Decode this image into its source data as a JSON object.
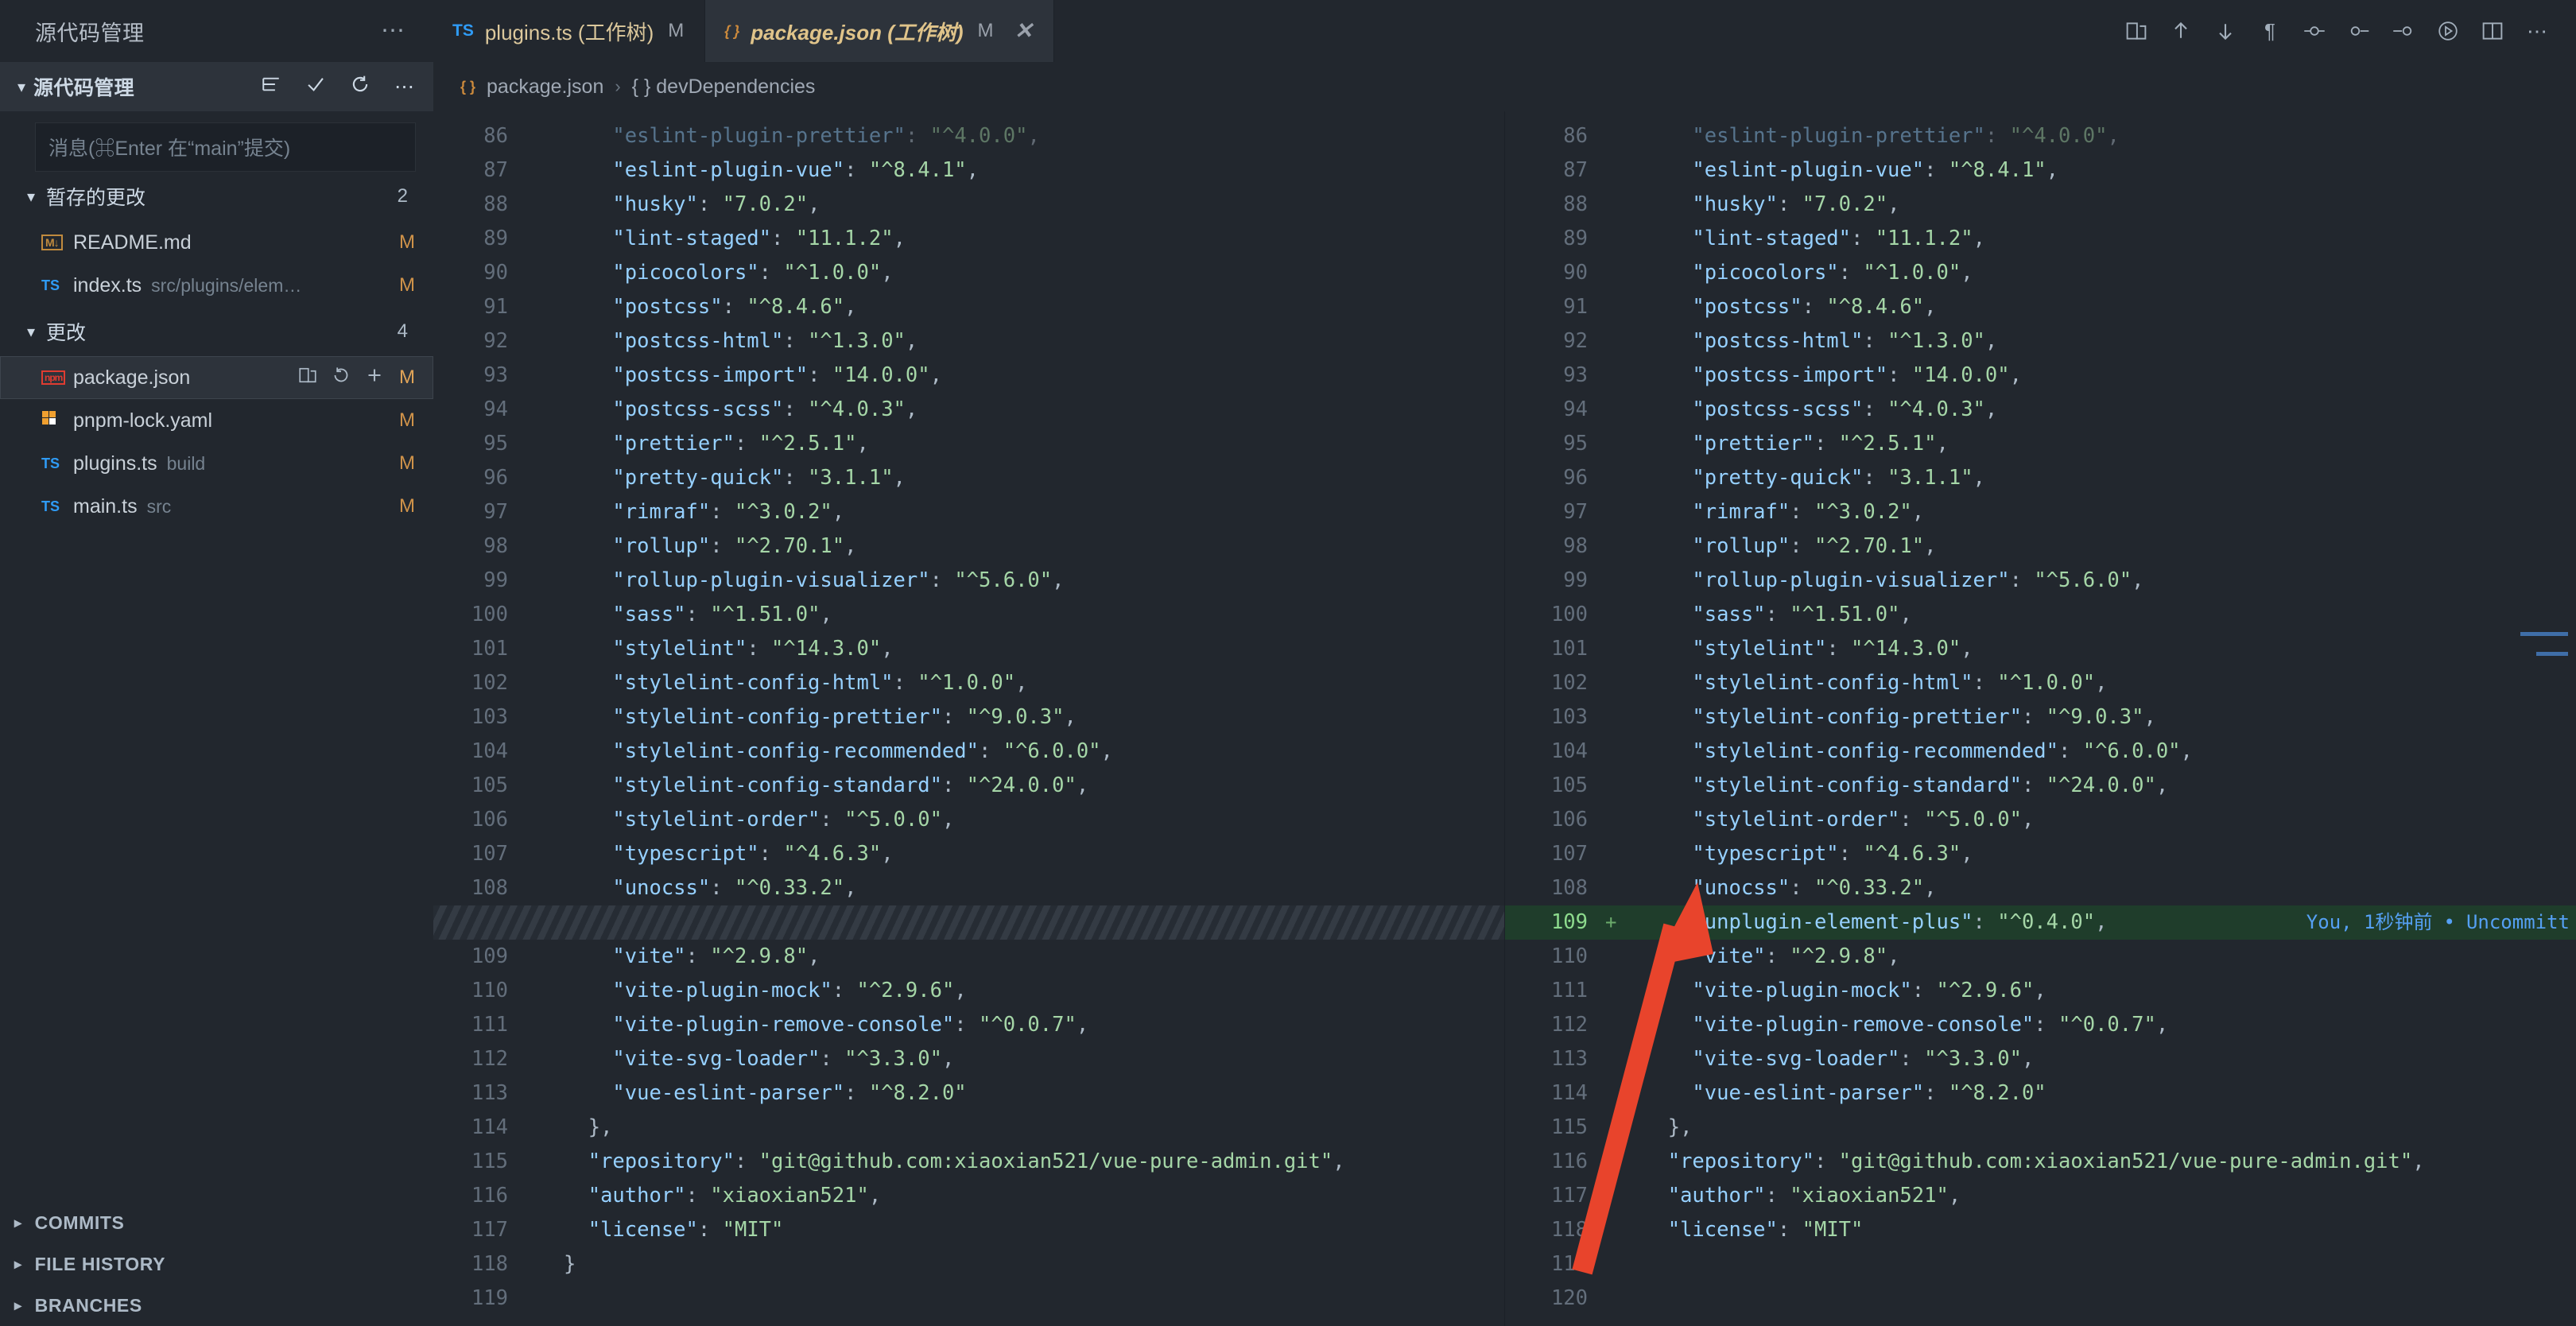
{
  "scm": {
    "title": "源代码管理",
    "more_icon": "ellipsis-icon",
    "subheader_title": "源代码管理",
    "actions": [
      "view-as-tree-icon",
      "commit-checkmark-icon",
      "refresh-icon",
      "ellipsis-icon"
    ],
    "commit_input_placeholder": "消息(⌘Enter 在“main”提交)",
    "sections": [
      {
        "label": "暂存的更改",
        "count": "2"
      },
      {
        "label": "更改",
        "count": "4"
      }
    ],
    "staged_files": [
      {
        "icon": "markdown-file-icon",
        "name": "README.md",
        "path": "",
        "status": "M",
        "selected": false
      },
      {
        "icon": "typescript-file-icon",
        "name": "index.ts",
        "path": "src/plugins/elem…",
        "status": "M",
        "selected": false
      }
    ],
    "changed_files": [
      {
        "icon": "npm-file-icon",
        "name": "package.json",
        "path": "",
        "status": "M",
        "selected": true,
        "row_actions": [
          "open-file-icon",
          "discard-changes-icon",
          "stage-changes-icon"
        ]
      },
      {
        "icon": "yaml-file-icon",
        "name": "pnpm-lock.yaml",
        "path": "",
        "status": "M",
        "selected": false
      },
      {
        "icon": "typescript-file-icon",
        "name": "plugins.ts",
        "path": "build",
        "status": "M",
        "selected": false
      },
      {
        "icon": "typescript-file-icon",
        "name": "main.ts",
        "path": "src",
        "status": "M",
        "selected": false
      }
    ],
    "bottom_sections": [
      "COMMITS",
      "FILE HISTORY",
      "BRANCHES"
    ]
  },
  "tabs": [
    {
      "icon": "typescript-file-icon",
      "label": "plugins.ts (工作树)",
      "badge": "M",
      "active": false,
      "closable": false
    },
    {
      "icon": "json-file-icon",
      "label": "package.json (工作树)",
      "badge": "M",
      "active": true,
      "closable": true
    }
  ],
  "title_actions": [
    "open-changes-icon",
    "previous-change-icon",
    "next-change-icon",
    "toggle-whitespace-icon",
    "toggle-inline-view-icon",
    "collapse-unchanged-icon",
    "expand-unchanged-icon",
    "run-icon",
    "split-editor-icon",
    "ellipsis-icon"
  ],
  "breadcrumb": {
    "icon": "json-file-icon",
    "items": [
      "package.json",
      "{ } devDependencies"
    ],
    "separator": "›"
  },
  "blame": {
    "author": "You,",
    "time": "1秒钟前",
    "dot": "•",
    "message": "Uncommitt"
  },
  "diff": {
    "left": [
      {
        "num": "86",
        "text": "    \"eslint-plugin-prettier\": \"^4.0.0\",",
        "faded": true
      },
      {
        "num": "87",
        "text": "    \"eslint-plugin-vue\": \"^8.4.1\","
      },
      {
        "num": "88",
        "text": "    \"husky\": \"7.0.2\","
      },
      {
        "num": "89",
        "text": "    \"lint-staged\": \"11.1.2\","
      },
      {
        "num": "90",
        "text": "    \"picocolors\": \"^1.0.0\","
      },
      {
        "num": "91",
        "text": "    \"postcss\": \"^8.4.6\","
      },
      {
        "num": "92",
        "text": "    \"postcss-html\": \"^1.3.0\","
      },
      {
        "num": "93",
        "text": "    \"postcss-import\": \"14.0.0\","
      },
      {
        "num": "94",
        "text": "    \"postcss-scss\": \"^4.0.3\","
      },
      {
        "num": "95",
        "text": "    \"prettier\": \"^2.5.1\","
      },
      {
        "num": "96",
        "text": "    \"pretty-quick\": \"3.1.1\","
      },
      {
        "num": "97",
        "text": "    \"rimraf\": \"^3.0.2\","
      },
      {
        "num": "98",
        "text": "    \"rollup\": \"^2.70.1\","
      },
      {
        "num": "99",
        "text": "    \"rollup-plugin-visualizer\": \"^5.6.0\","
      },
      {
        "num": "100",
        "text": "    \"sass\": \"^1.51.0\","
      },
      {
        "num": "101",
        "text": "    \"stylelint\": \"^14.3.0\","
      },
      {
        "num": "102",
        "text": "    \"stylelint-config-html\": \"^1.0.0\","
      },
      {
        "num": "103",
        "text": "    \"stylelint-config-prettier\": \"^9.0.3\","
      },
      {
        "num": "104",
        "text": "    \"stylelint-config-recommended\": \"^6.0.0\","
      },
      {
        "num": "105",
        "text": "    \"stylelint-config-standard\": \"^24.0.0\","
      },
      {
        "num": "106",
        "text": "    \"stylelint-order\": \"^5.0.0\","
      },
      {
        "num": "107",
        "text": "    \"typescript\": \"^4.6.3\","
      },
      {
        "num": "108",
        "text": "    \"unocss\": \"^0.33.2\","
      },
      {
        "num": "",
        "text": "",
        "hatch": true
      },
      {
        "num": "109",
        "text": "    \"vite\": \"^2.9.8\","
      },
      {
        "num": "110",
        "text": "    \"vite-plugin-mock\": \"^2.9.6\","
      },
      {
        "num": "111",
        "text": "    \"vite-plugin-remove-console\": \"^0.0.7\","
      },
      {
        "num": "112",
        "text": "    \"vite-svg-loader\": \"^3.3.0\","
      },
      {
        "num": "113",
        "text": "    \"vue-eslint-parser\": \"^8.2.0\""
      },
      {
        "num": "114",
        "text": "  },"
      },
      {
        "num": "115",
        "text": "  \"repository\": \"git@github.com:xiaoxian521/vue-pure-admin.git\","
      },
      {
        "num": "116",
        "text": "  \"author\": \"xiaoxian521\","
      },
      {
        "num": "117",
        "text": "  \"license\": \"MIT\""
      },
      {
        "num": "118",
        "text": "}"
      },
      {
        "num": "119",
        "text": ""
      }
    ],
    "right": [
      {
        "num": "86",
        "text": "    \"eslint-plugin-prettier\": \"^4.0.0\",",
        "faded": true
      },
      {
        "num": "87",
        "text": "    \"eslint-plugin-vue\": \"^8.4.1\","
      },
      {
        "num": "88",
        "text": "    \"husky\": \"7.0.2\","
      },
      {
        "num": "89",
        "text": "    \"lint-staged\": \"11.1.2\","
      },
      {
        "num": "90",
        "text": "    \"picocolors\": \"^1.0.0\","
      },
      {
        "num": "91",
        "text": "    \"postcss\": \"^8.4.6\","
      },
      {
        "num": "92",
        "text": "    \"postcss-html\": \"^1.3.0\","
      },
      {
        "num": "93",
        "text": "    \"postcss-import\": \"14.0.0\","
      },
      {
        "num": "94",
        "text": "    \"postcss-scss\": \"^4.0.3\","
      },
      {
        "num": "95",
        "text": "    \"prettier\": \"^2.5.1\","
      },
      {
        "num": "96",
        "text": "    \"pretty-quick\": \"3.1.1\","
      },
      {
        "num": "97",
        "text": "    \"rimraf\": \"^3.0.2\","
      },
      {
        "num": "98",
        "text": "    \"rollup\": \"^2.70.1\","
      },
      {
        "num": "99",
        "text": "    \"rollup-plugin-visualizer\": \"^5.6.0\","
      },
      {
        "num": "100",
        "text": "    \"sass\": \"^1.51.0\","
      },
      {
        "num": "101",
        "text": "    \"stylelint\": \"^14.3.0\","
      },
      {
        "num": "102",
        "text": "    \"stylelint-config-html\": \"^1.0.0\","
      },
      {
        "num": "103",
        "text": "    \"stylelint-config-prettier\": \"^9.0.3\","
      },
      {
        "num": "104",
        "text": "    \"stylelint-config-recommended\": \"^6.0.0\","
      },
      {
        "num": "105",
        "text": "    \"stylelint-config-standard\": \"^24.0.0\","
      },
      {
        "num": "106",
        "text": "    \"stylelint-order\": \"^5.0.0\","
      },
      {
        "num": "107",
        "text": "    \"typescript\": \"^4.6.3\","
      },
      {
        "num": "108",
        "text": "    \"unocss\": \"^0.33.2\","
      },
      {
        "num": "109",
        "text": "    \"unplugin-element-plus\": \"^0.4.0\",",
        "added": true,
        "sign": "+"
      },
      {
        "num": "110",
        "text": "    \"vite\": \"^2.9.8\","
      },
      {
        "num": "111",
        "text": "    \"vite-plugin-mock\": \"^2.9.6\","
      },
      {
        "num": "112",
        "text": "    \"vite-plugin-remove-console\": \"^0.0.7\","
      },
      {
        "num": "113",
        "text": "    \"vite-svg-loader\": \"^3.3.0\","
      },
      {
        "num": "114",
        "text": "    \"vue-eslint-parser\": \"^8.2.0\""
      },
      {
        "num": "115",
        "text": "  },"
      },
      {
        "num": "116",
        "text": "  \"repository\": \"git@github.com:xiaoxian521/vue-pure-admin.git\","
      },
      {
        "num": "117",
        "text": "  \"author\": \"xiaoxian521\","
      },
      {
        "num": "118",
        "text": "  \"license\": \"MIT\""
      },
      {
        "num": "119",
        "text": ""
      },
      {
        "num": "120",
        "text": ""
      }
    ]
  },
  "colors": {
    "background": "#22272e",
    "panel": "#2d333b",
    "accent_blue": "#58a6ff",
    "added_green": "#1f3d2b",
    "string_green": "#a5d6a7",
    "key_cyan": "#96d0ff",
    "arrow_red": "#e8442c"
  }
}
